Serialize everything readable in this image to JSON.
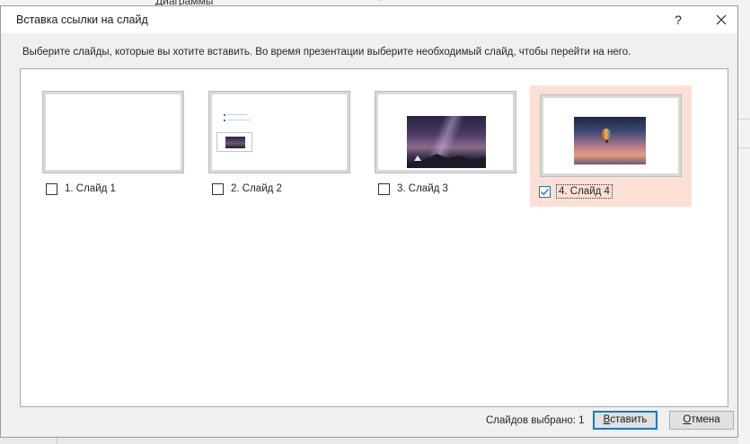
{
  "background_app": {
    "ribbon_item_label": "Диаграммы"
  },
  "dialog": {
    "title": "Вставка ссылки на слайд",
    "help_label": "?",
    "instruction": "Выберите слайды, которые вы хотите вставить. Во время презентации выберите необходимый слайд, чтобы перейти на него.",
    "slides": [
      {
        "label": "1. Слайд 1",
        "checked": false
      },
      {
        "label": "2. Слайд 2",
        "checked": false
      },
      {
        "label": "3. Слайд 3",
        "checked": false
      },
      {
        "label": "4. Слайд 4",
        "checked": true
      }
    ],
    "selected_count_text": "Слайдов выбрано: 1",
    "insert_button": {
      "accel": "В",
      "rest": "ставить"
    },
    "cancel_button": {
      "accel": "О",
      "rest": "тмена"
    }
  },
  "colors": {
    "selection_bg": "#fde0d5",
    "accent": "#0078d7",
    "dialog_bg": "#f0f0f0"
  }
}
